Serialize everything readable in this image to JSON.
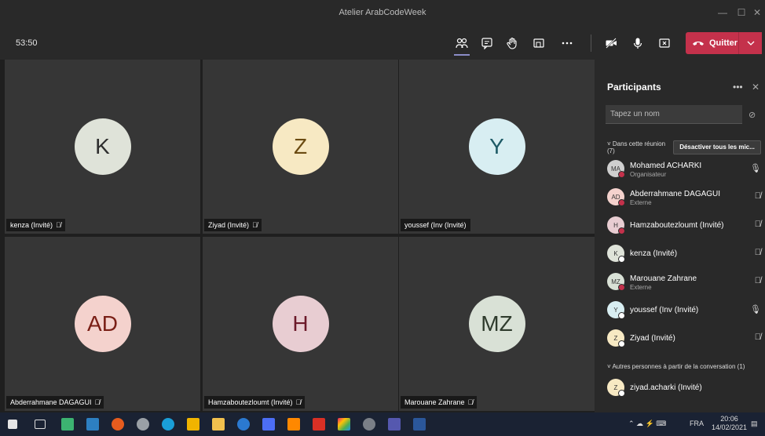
{
  "window": {
    "title": "Atelier ArabCodeWeek"
  },
  "toolbar": {
    "timer": "53:50",
    "quit_label": "Quitter"
  },
  "tiles": [
    {
      "initials": "K",
      "name": "kenza (Invité)",
      "muted": true,
      "color": "#dfe3d9",
      "text_color": "#2e2e2e"
    },
    {
      "initials": "Z",
      "name": "Ziyad (Invité)",
      "muted": true,
      "color": "#f7e9c3",
      "text_color": "#6b4b12"
    },
    {
      "initials": "Y",
      "name": "youssef (Inv (Invité)",
      "muted": false,
      "color": "#d8eef2",
      "text_color": "#1d5a66"
    },
    {
      "initials": "AD",
      "name": "Abderrahmane DAGAGUI",
      "muted": true,
      "color": "#f4d2cd",
      "text_color": "#7a1f16"
    },
    {
      "initials": "H",
      "name": "Hamzaboutezloumt (Invité)",
      "muted": true,
      "color": "#e8cdd2",
      "text_color": "#6b1a2a"
    },
    {
      "initials": "MZ",
      "name": "Marouane Zahrane",
      "muted": true,
      "color": "#d9e1d6",
      "text_color": "#2f3b2d"
    }
  ],
  "panel": {
    "title": "Participants",
    "search_placeholder": "Tapez un nom",
    "section_in_meeting": "Dans cette réunion",
    "section_count": "(7)",
    "mute_all": "Désactiver tous les mic...",
    "section_others": "Autres personnes à partir de la conversation (1)",
    "participants": [
      {
        "initials": "MA",
        "name": "Mohamed ACHARKI",
        "role": "Organisateur",
        "mic": "on",
        "status": "#c4314b",
        "color": "#cfcfcf"
      },
      {
        "initials": "AD",
        "name": "Abderrahmane DAGAGUI",
        "role": "Externe",
        "mic": "off",
        "status": "#c4314b",
        "color": "#f4d2cd"
      },
      {
        "initials": "H",
        "name": "Hamzaboutezloumt (Invité)",
        "role": "",
        "mic": "off",
        "status": "#c4314b",
        "color": "#e8cdd2"
      },
      {
        "initials": "K",
        "name": "kenza (Invité)",
        "role": "",
        "mic": "off",
        "status": "#ffffff",
        "color": "#dfe3d9"
      },
      {
        "initials": "MZ",
        "name": "Marouane Zahrane",
        "role": "Externe",
        "mic": "off",
        "status": "#c4314b",
        "color": "#d9e1d6"
      },
      {
        "initials": "Y",
        "name": "youssef (Inv (Invité)",
        "role": "",
        "mic": "on",
        "status": "#ffffff",
        "color": "#d8eef2"
      },
      {
        "initials": "Z",
        "name": "Ziyad (Invité)",
        "role": "",
        "mic": "off",
        "status": "#ffffff",
        "color": "#f7e9c3"
      }
    ],
    "others": [
      {
        "initials": "Z",
        "name": "ziyad.acharki (Invité)",
        "status": "#ffffff",
        "color": "#f7e9c3"
      }
    ]
  },
  "taskbar": {
    "language": "FRA",
    "time": "20:06",
    "date": "14/02/2021"
  }
}
